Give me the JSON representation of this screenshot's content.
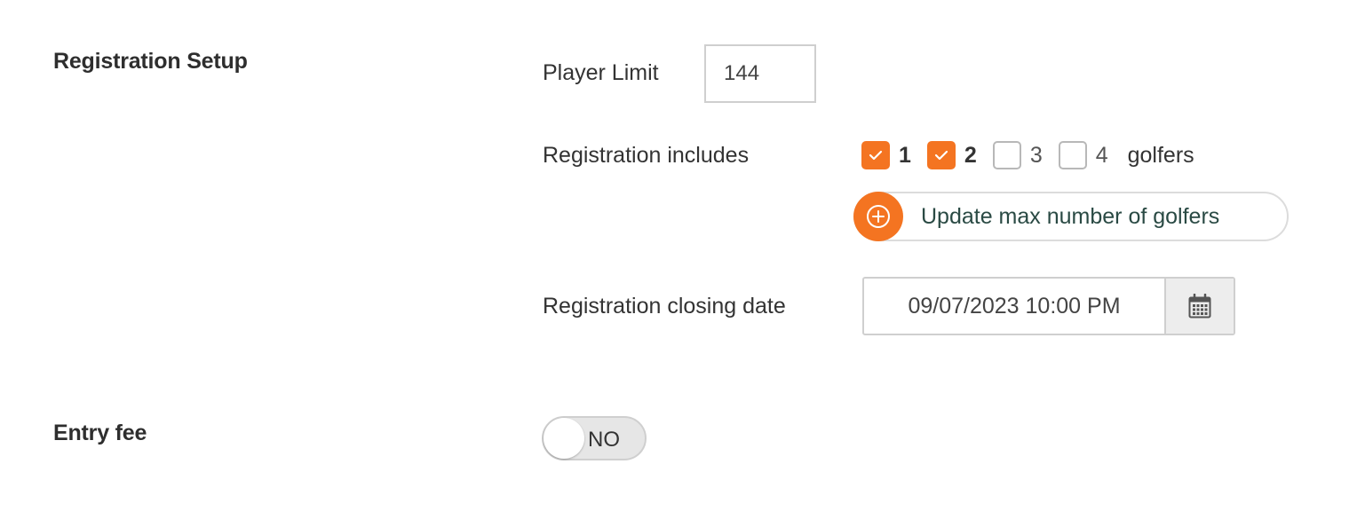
{
  "registration_setup": {
    "title": "Registration Setup",
    "player_limit": {
      "label": "Player Limit",
      "value": "144"
    },
    "includes": {
      "label": "Registration includes",
      "options": [
        {
          "label": "1",
          "checked": true
        },
        {
          "label": "2",
          "checked": true
        },
        {
          "label": "3",
          "checked": false
        },
        {
          "label": "4",
          "checked": false
        }
      ],
      "suffix": "golfers"
    },
    "update_button": {
      "label": "Update max number of golfers",
      "icon": "plus-circle-icon"
    },
    "closing_date": {
      "label": "Registration closing date",
      "value": "09/07/2023 10:00 PM",
      "icon": "calendar-icon"
    }
  },
  "entry_fee": {
    "title": "Entry fee",
    "toggle": {
      "label": "NO",
      "on": false
    }
  },
  "colors": {
    "accent": "#f47421",
    "button_text": "#2a4a44"
  }
}
